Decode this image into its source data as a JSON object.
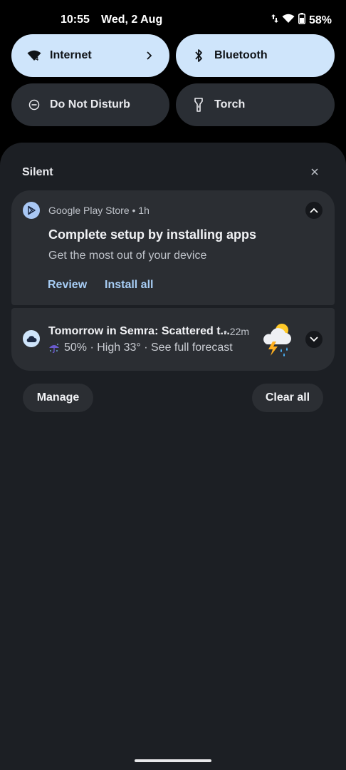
{
  "status_bar": {
    "time": "10:55",
    "date": "Wed, 2 Aug",
    "battery": "58%",
    "icons": [
      "data-arrows-icon",
      "wifi-icon",
      "battery-icon"
    ]
  },
  "quick_tiles": [
    {
      "label": "Internet",
      "state": "on",
      "icon": "wifi-icon"
    },
    {
      "label": "Bluetooth",
      "state": "on",
      "icon": "bluetooth-icon"
    },
    {
      "label": "Do Not Disturb",
      "state": "off",
      "icon": "dnd-icon"
    },
    {
      "label": "Torch",
      "state": "off",
      "icon": "torch-icon"
    }
  ],
  "section": {
    "title": "Silent"
  },
  "notifications": [
    {
      "app": "Google Play Store • 1h",
      "title": "Complete setup by installing apps",
      "text": "Get the most out of your device",
      "actions": [
        "Review",
        "Install all"
      ]
    },
    {
      "title": "Tomorrow in Semra: Scattered t...",
      "time": "• 22m",
      "summary": "50% · High 33° · See full forecast",
      "icon": "thunderstorm-icon"
    }
  ],
  "buttons": {
    "manage": "Manage",
    "clear_all": "Clear all"
  },
  "colors": {
    "tile_on": "#cfe5fb",
    "tile_off": "#2a2e34",
    "shade": "#1c1f24",
    "card": "#2b2e33",
    "accent_text": "#a7cdf5"
  }
}
